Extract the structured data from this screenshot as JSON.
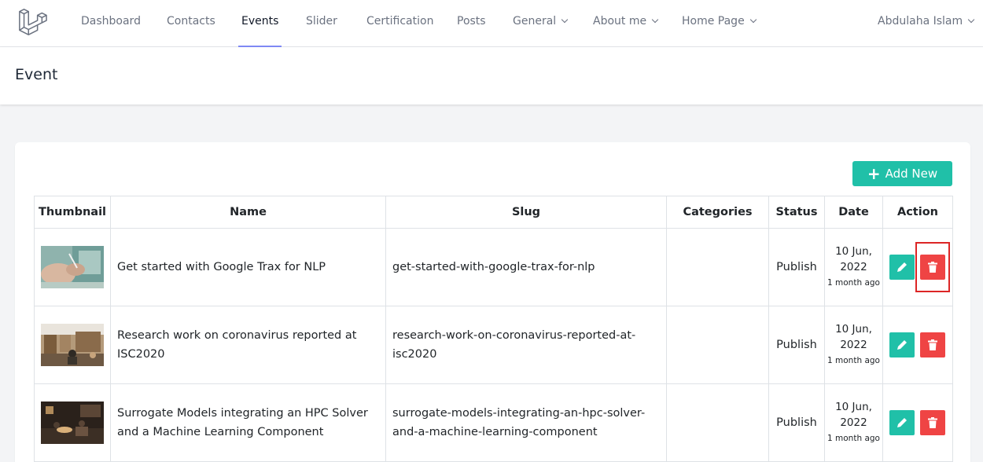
{
  "nav": {
    "items": [
      {
        "label": "Dashboard",
        "dropdown": false,
        "active": false
      },
      {
        "label": "Contacts",
        "dropdown": false,
        "active": false
      },
      {
        "label": "Events",
        "dropdown": false,
        "active": true
      },
      {
        "label": "Slider",
        "dropdown": false,
        "active": false
      },
      {
        "label": "Certification",
        "dropdown": false,
        "active": false
      },
      {
        "label": "Posts",
        "dropdown": false,
        "active": false
      },
      {
        "label": "General",
        "dropdown": true,
        "active": false
      },
      {
        "label": "About me",
        "dropdown": true,
        "active": false
      },
      {
        "label": "Home Page",
        "dropdown": true,
        "active": false
      }
    ],
    "user": "Abdulaha Islam"
  },
  "header": {
    "title": "Event"
  },
  "toolbar": {
    "add_label": "Add New",
    "add_icon": "plus-icon"
  },
  "table": {
    "columns": [
      "Thumbnail",
      "Name",
      "Slug",
      "Categories",
      "Status",
      "Date",
      "Action"
    ],
    "rows": [
      {
        "name": "Get started with Google Trax for NLP",
        "slug": "get-started-with-google-trax-for-nlp",
        "categories": "",
        "status": "Publish",
        "date": "10 Jun, 2022",
        "ago": "1 month ago",
        "thumbnail": "hands-on-desk-photo"
      },
      {
        "name": "Research work on coronavirus reported at ISC2020",
        "slug": "research-work-on-coronavirus-reported-at-isc2020",
        "categories": "",
        "status": "Publish",
        "date": "10 Jun, 2022",
        "ago": "1 month ago",
        "thumbnail": "library-room-photo"
      },
      {
        "name": "Surrogate Models integrating an HPC Solver and a Machine Learning Component",
        "slug": "surrogate-models-integrating-an-hpc-solver-and-a-machine-learning-component",
        "categories": "",
        "status": "Publish",
        "date": "10 Jun, 2022",
        "ago": "1 month ago",
        "thumbnail": "dark-office-photo"
      }
    ]
  },
  "colors": {
    "accent": "#20c0a8",
    "danger": "#ef4444",
    "nav_underline": "#818cf8",
    "highlight": "#dc2626"
  }
}
